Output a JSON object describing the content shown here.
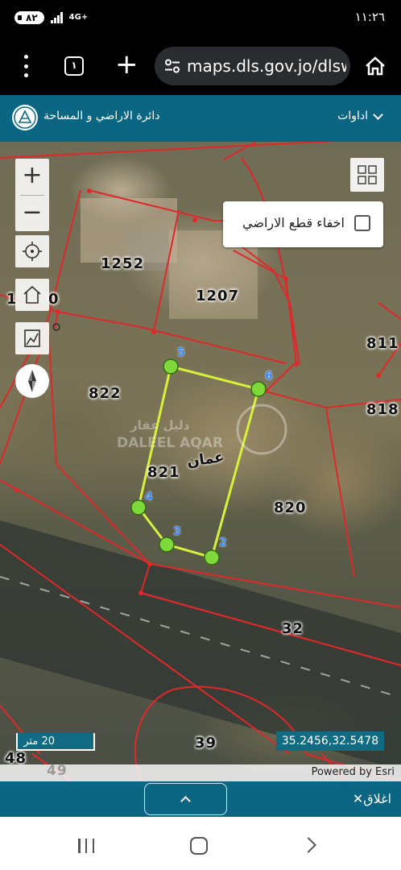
{
  "status_bar": {
    "battery": "٨٢",
    "network": "4G+",
    "time": "١١:٢٦"
  },
  "browser": {
    "tab_count": "١",
    "url": "maps.dls.gov.jo/dlsw",
    "icons": [
      "more-vert-icon",
      "tabs-icon",
      "plus-icon",
      "site-settings-icon",
      "home-icon"
    ]
  },
  "header": {
    "title": "دائرة الاراضي و المساحة",
    "tools_label": "اداوات"
  },
  "map": {
    "hide_parcels_label": "اخفاء قطع الاراضي",
    "hide_parcels_checked": false,
    "parcels": {
      "p1252": "1252",
      "p1207": "1207",
      "p822": "822",
      "p821": "821",
      "p820": "820",
      "p811": "811",
      "p818": "818",
      "p32": "32",
      "p39": "39",
      "p48": "48",
      "p49": "49",
      "p1_partial": "1",
      "p0_partial": "0"
    },
    "vertices": [
      "2",
      "3",
      "4",
      "5",
      "6"
    ],
    "city_label": "عمان",
    "watermark_arabic": "دليل عقار",
    "watermark_latin": "DALEEL AQAR",
    "scale_label": "20 متر",
    "coordinates": "35.2456,32.5478",
    "attribution": "Powered by Esri",
    "colors": {
      "parcel_border": "#e0282a",
      "selected_outline": "#d7f13a",
      "vertex_fill": "#7fd93a",
      "panel": "#0b6683"
    }
  },
  "bottom_panel": {
    "close_label": "اغلاق"
  }
}
